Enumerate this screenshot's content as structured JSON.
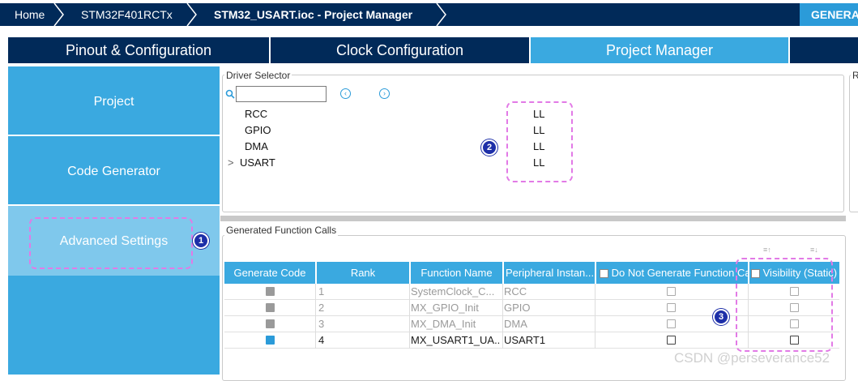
{
  "breadcrumb": {
    "home": "Home",
    "device": "STM32F401RCTx",
    "file": "STM32_USART.ioc - Project Manager",
    "generate": "GENERA"
  },
  "tabs": [
    {
      "label": "Pinout & Configuration",
      "active": false
    },
    {
      "label": "Clock Configuration",
      "active": false
    },
    {
      "label": "Project Manager",
      "active": true
    }
  ],
  "sidebar": {
    "items": [
      {
        "label": "Project",
        "active": false
      },
      {
        "label": "Code Generator",
        "active": false
      },
      {
        "label": "Advanced Settings",
        "active": true
      }
    ]
  },
  "driver_selector": {
    "title": "Driver Selector",
    "search_value": "",
    "rows": [
      {
        "name": "RCC",
        "driver": "LL",
        "expandable": false
      },
      {
        "name": "GPIO",
        "driver": "LL",
        "expandable": false
      },
      {
        "name": "DMA",
        "driver": "LL",
        "expandable": false
      },
      {
        "name": "USART",
        "driver": "LL",
        "expandable": true
      }
    ],
    "expand_glyph": ">"
  },
  "right_panel_letter": "R",
  "generated_calls": {
    "title": "Generated Function Calls",
    "headers": [
      "Generate Code",
      "Rank",
      "Function Name",
      "Peripheral Instan...",
      "Do Not Generate Function Cal",
      "Visibility (Static)"
    ],
    "rows": [
      {
        "generate": true,
        "enabled": false,
        "rank": "1",
        "function": "SystemClock_C...",
        "peripheral": "RCC",
        "no_generate": false,
        "visibility": false
      },
      {
        "generate": true,
        "enabled": false,
        "rank": "2",
        "function": "MX_GPIO_Init",
        "peripheral": "GPIO",
        "no_generate": false,
        "visibility": false
      },
      {
        "generate": true,
        "enabled": false,
        "rank": "3",
        "function": "MX_DMA_Init",
        "peripheral": "DMA",
        "no_generate": false,
        "visibility": false
      },
      {
        "generate": true,
        "enabled": true,
        "rank": "4",
        "function": "MX_USART1_UA...",
        "peripheral": "USART1",
        "no_generate": false,
        "visibility": false
      }
    ]
  },
  "annotations": [
    "1",
    "2",
    "3"
  ],
  "watermark": "CSDN @perseverance52",
  "colors": {
    "navy": "#012a59",
    "accent": "#3aa9e0",
    "active_side": "#7fc8ec",
    "annotation_dash": "#e27ae6",
    "badge": "#1d2fa8"
  },
  "icons": [
    "search-icon",
    "chevron-right-icon",
    "arrow-left-circle-icon",
    "arrow-right-circle-icon",
    "sort-up-icon",
    "sort-down-icon"
  ]
}
